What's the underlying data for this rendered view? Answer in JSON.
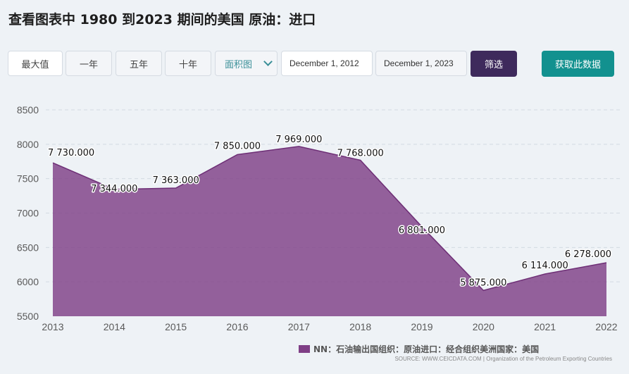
{
  "page_title": "查看图表中 1980 到2023 期间的美国 原油：进口",
  "toolbar": {
    "max_label": "最大值",
    "one_year_label": "一年",
    "five_year_label": "五年",
    "ten_year_label": "十年",
    "chart_type_selected": "面积图",
    "start_date": "December 1, 2012",
    "end_date": "December 1, 2023",
    "filter_label": "筛选",
    "get_data_label": "获取此数据"
  },
  "legend": {
    "label": "NN：石油输出国组织：原油进口：经合组织美洲国家：美国"
  },
  "source": "SOURCE: WWW.CEICDATA.COM | Organization of the Petroleum Exporting Countries",
  "chart_data": {
    "type": "area",
    "x": [
      "2013",
      "2014",
      "2015",
      "2016",
      "2017",
      "2018",
      "2019",
      "2020",
      "2021",
      "2022"
    ],
    "series": [
      {
        "name": "NN：石油输出国组织：原油进口：经合组织美洲国家：美国",
        "values": [
          7730,
          7344,
          7363,
          7850,
          7969,
          7768,
          6801,
          5875,
          6114,
          6278
        ],
        "labels": [
          "7 730.000",
          "7 344.000",
          "7 363.000",
          "7 850.000",
          "7 969.000",
          "7 768.000",
          "6 801.000",
          "5 875.000",
          "6 114.000",
          "6 278.000"
        ]
      }
    ],
    "y_ticks": [
      "5500",
      "6000",
      "6500",
      "7000",
      "7500",
      "8000",
      "8500"
    ],
    "ylim": [
      5500,
      8500
    ],
    "grid": true,
    "legend_position": "bottom-right",
    "color": "#7f3f86"
  }
}
